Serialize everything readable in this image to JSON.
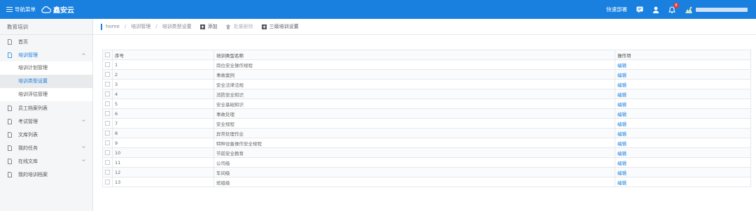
{
  "header": {
    "nav_toggle_label": "导航菜单",
    "logo_text": "鑫安云",
    "quick_nav_label": "快速部署",
    "notification_count": "8",
    "brand_color": "#1a80e0"
  },
  "sidebar": {
    "title": "教育培训",
    "items": [
      {
        "label": "首页"
      },
      {
        "label": "培训管理",
        "expanded": true,
        "children": [
          {
            "label": "培训计划管理"
          },
          {
            "label": "培训类型设置",
            "selected": true
          },
          {
            "label": "培训评估管理"
          }
        ]
      },
      {
        "label": "员工档案列表"
      },
      {
        "label": "考试管理",
        "has_children": true
      },
      {
        "label": "文库列表"
      },
      {
        "label": "我的任务",
        "has_children": true
      },
      {
        "label": "在线文库",
        "has_children": true
      },
      {
        "label": "我的培训档案"
      }
    ]
  },
  "breadcrumb": [
    "home",
    "培训管理",
    "培训类型设置"
  ],
  "toolbar": {
    "add_label": "添加",
    "batch_delete_label": "批量删除",
    "level3_settings_label": "三级培训设置"
  },
  "table": {
    "columns": [
      "序号",
      "培训类型名称",
      "操作项"
    ],
    "rows": [
      {
        "no": "1",
        "name": "岗位安全操作规程",
        "action": "编辑"
      },
      {
        "no": "2",
        "name": "事故案例",
        "action": "编辑"
      },
      {
        "no": "3",
        "name": "安全法律法规",
        "action": "编辑"
      },
      {
        "no": "4",
        "name": "消防安全知识",
        "action": "编辑"
      },
      {
        "no": "5",
        "name": "安全基础知识",
        "action": "编辑"
      },
      {
        "no": "6",
        "name": "事故处理",
        "action": "编辑"
      },
      {
        "no": "7",
        "name": "安全规程",
        "action": "编辑"
      },
      {
        "no": "8",
        "name": "异常处理作业",
        "action": "编辑"
      },
      {
        "no": "9",
        "name": "特种设备操作安全规程",
        "action": "编辑"
      },
      {
        "no": "10",
        "name": "节前安全教育",
        "action": "编辑"
      },
      {
        "no": "11",
        "name": "公司级",
        "action": "编辑"
      },
      {
        "no": "12",
        "name": "车间级",
        "action": "编辑"
      },
      {
        "no": "13",
        "name": "班组级",
        "action": "编辑"
      }
    ]
  }
}
